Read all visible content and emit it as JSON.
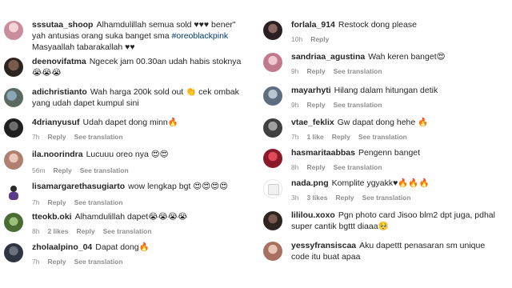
{
  "left": [
    {
      "user": "sssutaa_shoop",
      "text": "Alhamdulillah semua sold ♥♥♥ bener\" yah antusias orang suka banget sma ",
      "tag": "#oreoblackpink",
      "text2": " Masyaallah tabarakallah ♥♥",
      "time": "",
      "likes": "",
      "reply": "",
      "see": ""
    },
    {
      "user": "deenovifatma",
      "text": "Ngecek jam 00.30an udah habis stoknya 😭😭😭",
      "tag": "",
      "text2": "",
      "time": "",
      "likes": "",
      "reply": "",
      "see": ""
    },
    {
      "user": "adichristianto",
      "text": "Wah harga 200k sold out 👏 cek ombak yang udah dapet kumpul sini",
      "tag": "",
      "text2": "",
      "time": "",
      "likes": "",
      "reply": "",
      "see": ""
    },
    {
      "user": "4drianyusuf",
      "text": "Udah dapet dong minn🔥",
      "tag": "",
      "text2": "",
      "time": "7h",
      "likes": "",
      "reply": "Reply",
      "see": "See translation"
    },
    {
      "user": "ila.noorindra",
      "text": "Lucuuu oreo nya 😍😍",
      "tag": "",
      "text2": "",
      "time": "56m",
      "likes": "",
      "reply": "Reply",
      "see": "See translation"
    },
    {
      "user": "lisamargarethasugiarto",
      "text": "wow lengkap bgt 😍😍😍😍",
      "tag": "",
      "text2": "",
      "time": "7h",
      "likes": "",
      "reply": "Reply",
      "see": "See translation"
    },
    {
      "user": "tteokb.oki",
      "text": "Alhamdulillah dapet😭😭😭😭",
      "tag": "",
      "text2": "",
      "time": "8h",
      "likes": "2 likes",
      "reply": "Reply",
      "see": "See translation"
    },
    {
      "user": "zholaalpino_04",
      "text": "Dapat dong🔥",
      "tag": "",
      "text2": "",
      "time": "7h",
      "likes": "",
      "reply": "Reply",
      "see": "See translation"
    }
  ],
  "right": [
    {
      "user": "forlala_914",
      "text": "Restock dong please",
      "time": "10h",
      "likes": "",
      "reply": "Reply",
      "see": ""
    },
    {
      "user": "sandriaa_agustina",
      "text": "Wah keren banget😍",
      "time": "9h",
      "likes": "",
      "reply": "Reply",
      "see": "See translation"
    },
    {
      "user": "mayarhyti",
      "text": "Hilang dalam hitungan detik",
      "time": "9h",
      "likes": "",
      "reply": "Reply",
      "see": "See translation"
    },
    {
      "user": "vtae_feklix",
      "text": "Gw dapat dong hehe 🔥",
      "time": "7h",
      "likes": "1 like",
      "reply": "Reply",
      "see": "See translation"
    },
    {
      "user": "hasmaritaabbas",
      "text": "Pengenn banget",
      "time": "8h",
      "likes": "",
      "reply": "Reply",
      "see": "See translation"
    },
    {
      "user": "nada.png",
      "text": "Komplite ygyakk♥🔥🔥🔥",
      "time": "3h",
      "likes": "3 likes",
      "reply": "Reply",
      "see": "See translation"
    },
    {
      "user": "lililou.xoxo",
      "text": "Pgn photo card Jisoo blm2 dpt juga, pdhal super cantik bgttt diaaa🥺",
      "time": "",
      "likes": "",
      "reply": "",
      "see": ""
    },
    {
      "user": "yessyfransiscaa",
      "text": "Aku dapettt penasaran sm unique code itu buat apaa",
      "time": "",
      "likes": "",
      "reply": "",
      "see": ""
    }
  ]
}
